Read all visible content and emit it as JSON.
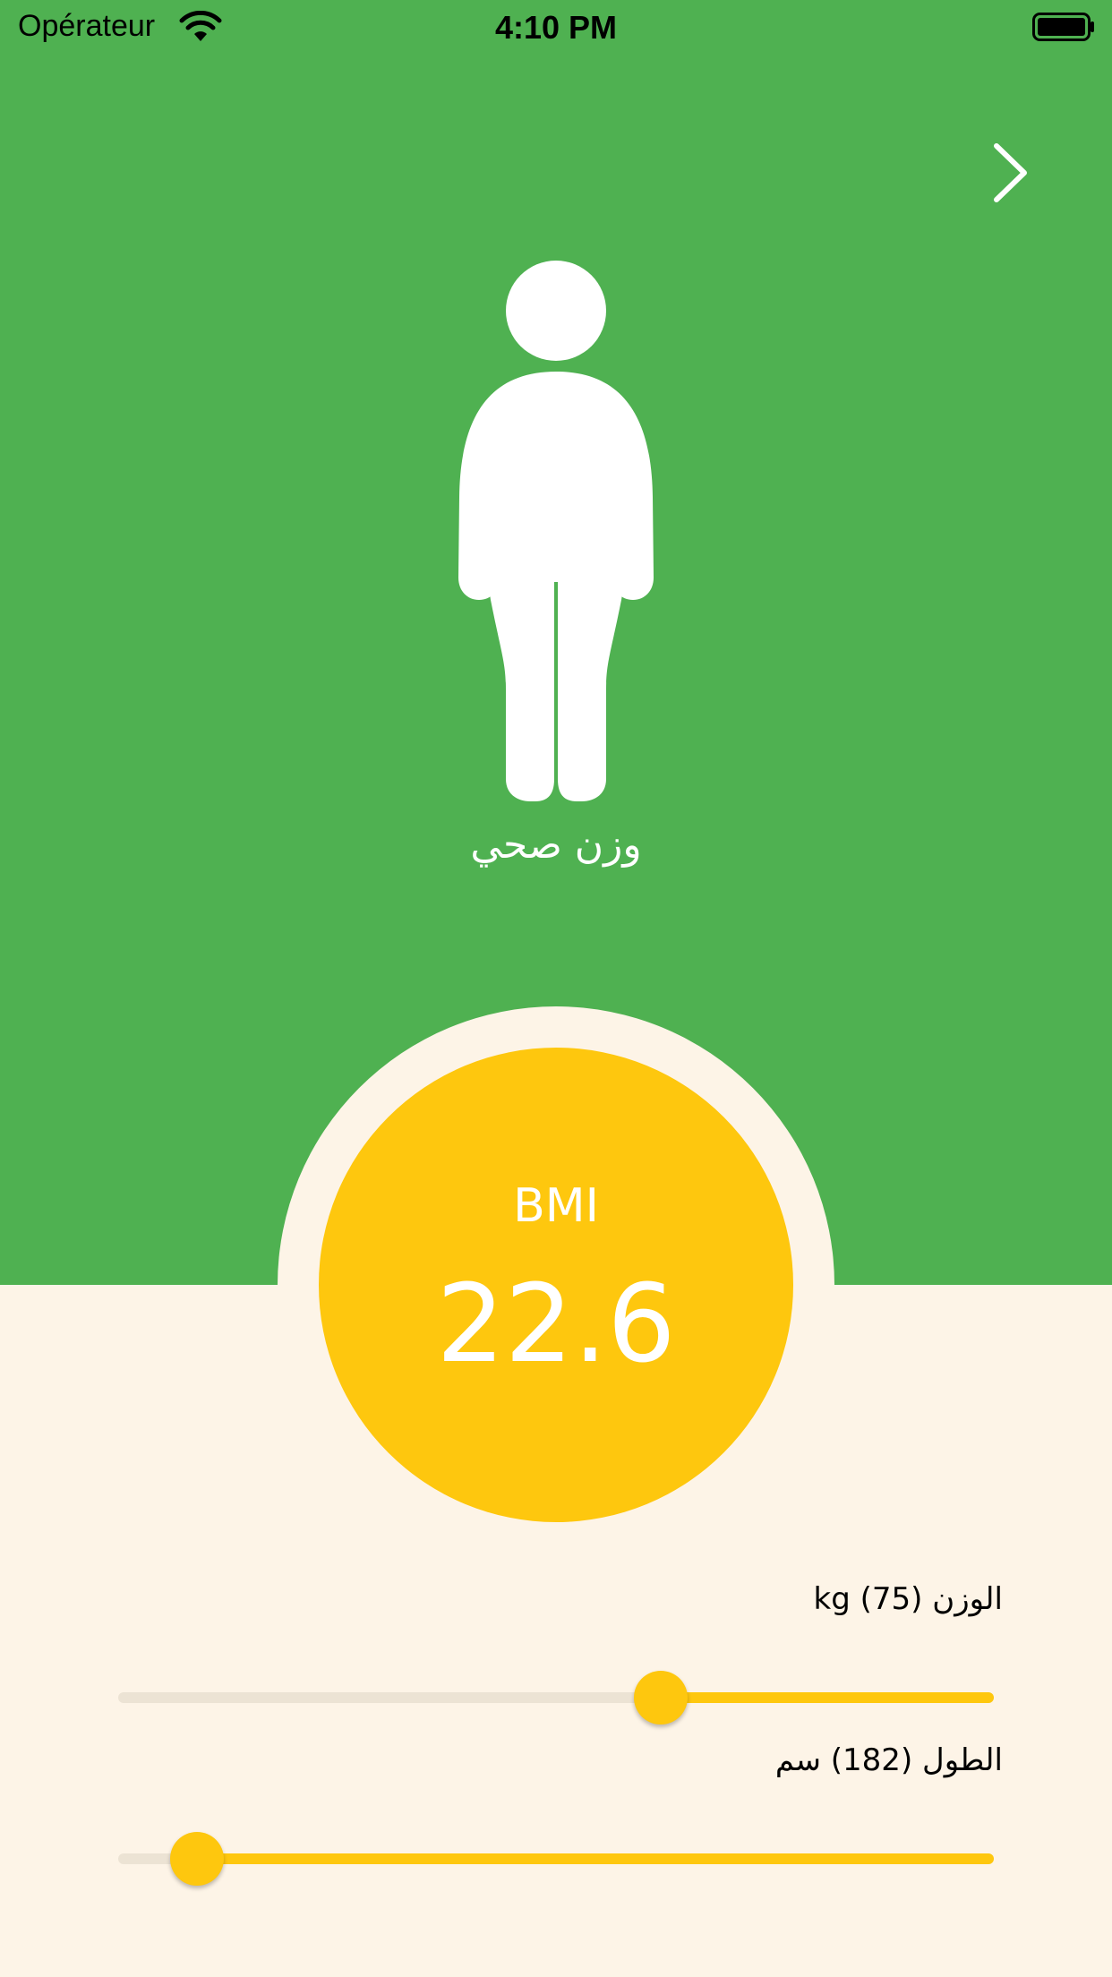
{
  "status_bar": {
    "carrier": "Opérateur",
    "time": "4:10 PM"
  },
  "result": {
    "category": "وزن صحي",
    "bmi_label": "BMI",
    "bmi_value": "22.6"
  },
  "weight": {
    "label": "الوزن (75) kg",
    "value": 75,
    "fill_fraction": 0.62,
    "fill_direction": "right"
  },
  "height": {
    "label": "الطول (182) سم",
    "value": 182,
    "fill_fraction": 0.09,
    "fill_direction": "right"
  },
  "colors": {
    "top_background": "#4FB151",
    "bottom_background": "#FDF4E7",
    "accent": "#FEC70E",
    "track": "#ECE3D4"
  }
}
